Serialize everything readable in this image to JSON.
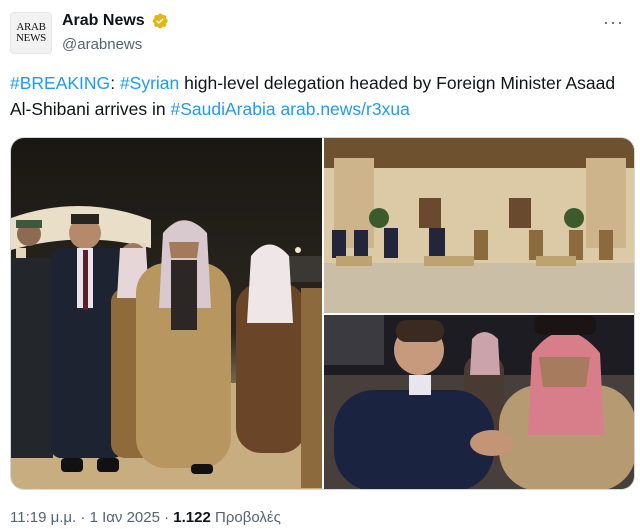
{
  "account": {
    "avatar_line1": "ARAB",
    "avatar_line2": "NEWS",
    "name": "Arab News",
    "handle": "@arabnews",
    "verified_color": "#e2b719"
  },
  "tweet": {
    "hashtag_breaking": "#BREAKING",
    "colon": ":",
    "hashtag_syrian": "#Syrian",
    "text_main": " high-level delegation headed by Foreign Minister Asaad Al-Shibani arrives in ",
    "hashtag_saudi": "#SaudiArabia",
    "link": "arab.news/r3xua"
  },
  "media": {
    "count": 3
  },
  "meta": {
    "time": "11:19 μ.μ.",
    "separator": " · ",
    "date": "1 Ιαν 2025",
    "views_count": "1.122",
    "views_label": "Προβολές"
  },
  "colors": {
    "link": "#1d9bf0",
    "secondary_text": "#536471",
    "primary_text": "#0f1419"
  }
}
